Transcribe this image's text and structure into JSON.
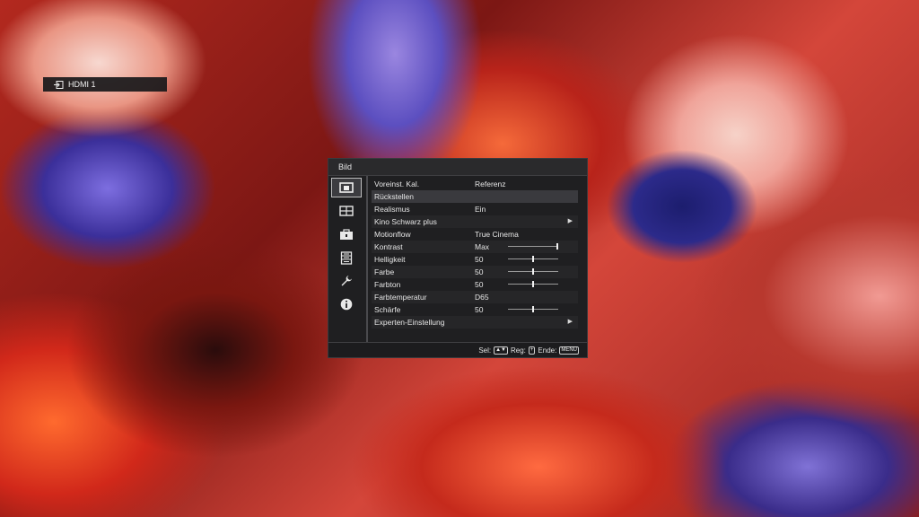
{
  "source": {
    "icon": "input-icon",
    "label": "HDMI 1"
  },
  "menu": {
    "title": "Bild",
    "categories": [
      {
        "icon": "picture-icon",
        "selected": true
      },
      {
        "icon": "screen-icon",
        "selected": false
      },
      {
        "icon": "setup-icon",
        "selected": false
      },
      {
        "icon": "function-icon",
        "selected": false
      },
      {
        "icon": "wrench-icon",
        "selected": false
      },
      {
        "icon": "info-icon",
        "selected": false
      }
    ],
    "items": [
      {
        "label": "Voreinst. Kal.",
        "value": "Referenz"
      },
      {
        "label": "Rückstellen",
        "value": ""
      },
      {
        "label": "Realismus",
        "value": "Ein"
      },
      {
        "label": "Kino Schwarz plus",
        "value": "",
        "arrow": "▶"
      },
      {
        "label": "Motionflow",
        "value": "True Cinema"
      },
      {
        "label": "Kontrast",
        "value": "Max",
        "slider": 1.0
      },
      {
        "label": "Helligkeit",
        "value": "50",
        "slider": 0.5
      },
      {
        "label": "Farbe",
        "value": "50",
        "slider": 0.5
      },
      {
        "label": "Farbton",
        "value": "50",
        "slider": 0.5
      },
      {
        "label": "Farbtemperatur",
        "value": "D65"
      },
      {
        "label": "Schärfe",
        "value": "50",
        "slider": 0.5
      },
      {
        "label": "Experten-Einstellung",
        "value": "",
        "arrow": "▶"
      }
    ],
    "footer": {
      "sel_label": "Sel:",
      "sel_keys": "▲▼",
      "reg_label": "Reg:",
      "reg_key": "+",
      "end_label": "Ende:",
      "end_key": "MENU"
    }
  }
}
